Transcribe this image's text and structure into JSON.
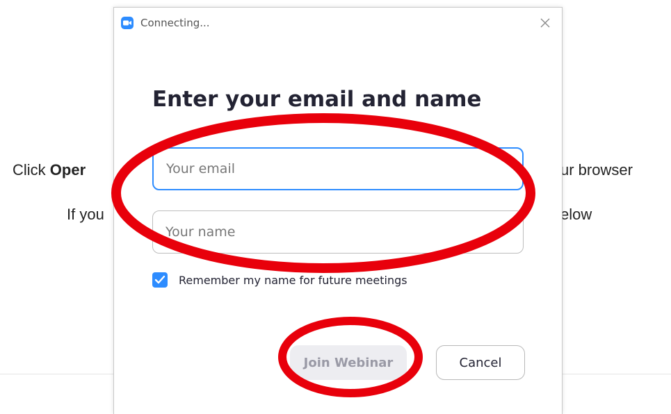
{
  "background_page": {
    "line1_prefix": "Click ",
    "line1_bold": "Oper",
    "line1_suffix": "ur browser",
    "line2_prefix": "If you",
    "line2_suffix": "elow"
  },
  "dialog": {
    "title": "Connecting...",
    "heading": "Enter your email and name",
    "email_placeholder": "Your email",
    "name_placeholder": "Your name",
    "remember_label": "Remember my name for future meetings",
    "remember_checked": true,
    "join_label": "Join Webinar",
    "cancel_label": "Cancel",
    "icons": {
      "app": "zoom-camera-icon",
      "close": "close-icon",
      "check": "checkmark-icon"
    }
  },
  "colors": {
    "accent": "#2d8cff",
    "annotation": "#e8000b",
    "disabled_button_bg": "#ededf1",
    "disabled_button_text": "#9a9aa6"
  },
  "annotations": {
    "count": 2,
    "style": "red-ellipse",
    "targets": [
      "email-and-name-fields",
      "join-webinar-button"
    ]
  }
}
